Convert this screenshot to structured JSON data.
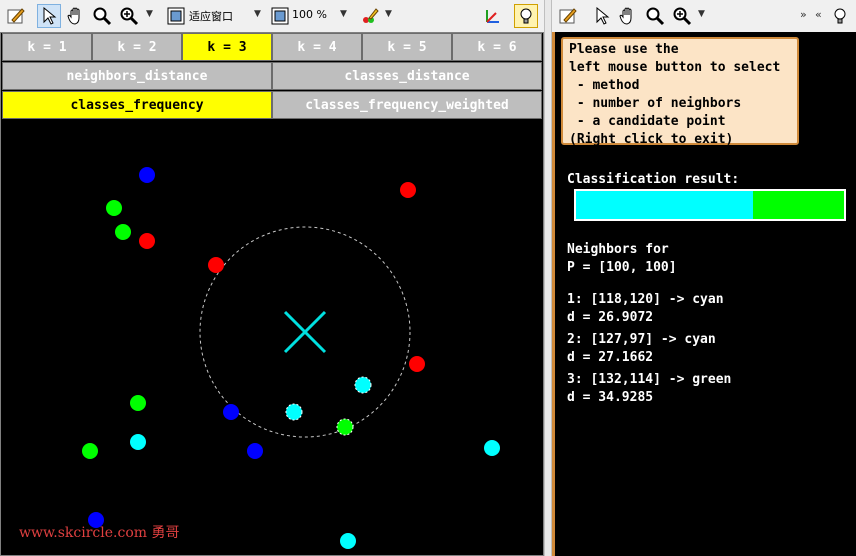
{
  "toolbar_left": {
    "zoom_mode": "适应窗口",
    "zoom_percent": "100 %"
  },
  "k_buttons": [
    {
      "label": "k = 1"
    },
    {
      "label": "k = 2"
    },
    {
      "label": "k = 3"
    },
    {
      "label": "k = 4"
    },
    {
      "label": "k = 5"
    },
    {
      "label": "k = 6"
    }
  ],
  "selected_k": "k = 3",
  "method_buttons": {
    "neighbors_distance": "neighbors_distance",
    "classes_distance": "classes_distance",
    "classes_frequency": "classes_frequency",
    "classes_frequency_weighted": "classes_frequency_weighted"
  },
  "selected_method": "classes_frequency",
  "watermark": "www.skcircle.com 勇哥",
  "colors": {
    "red": "#ff0000",
    "green": "#00ff00",
    "blue": "#0000ff",
    "cyan": "#00ffff",
    "selected": "#ffff00",
    "button": "#bebebe",
    "help_bg": "#fce4c6",
    "help_border": "#d08a3a"
  },
  "help": {
    "lines": [
      "Please use the",
      "left mouse button to select",
      " - method",
      " - number of neighbors",
      " - a candidate point",
      "(Right click to exit)"
    ]
  },
  "result": {
    "title": "Classification result:",
    "bar_segments": [
      {
        "color": "#00ffff",
        "fraction": 0.66
      },
      {
        "color": "#00ff00",
        "fraction": 0.34
      }
    ]
  },
  "neighbors": {
    "title": "Neighbors for",
    "point": "P = [100, 100]",
    "items": [
      {
        "line": "1: [118,120] -> cyan",
        "dist": "d = 26.9072"
      },
      {
        "line": "2: [127,97] -> cyan",
        "dist": "d = 27.1662"
      },
      {
        "line": "3: [132,114] -> green",
        "dist": "d = 34.9285"
      }
    ]
  }
}
